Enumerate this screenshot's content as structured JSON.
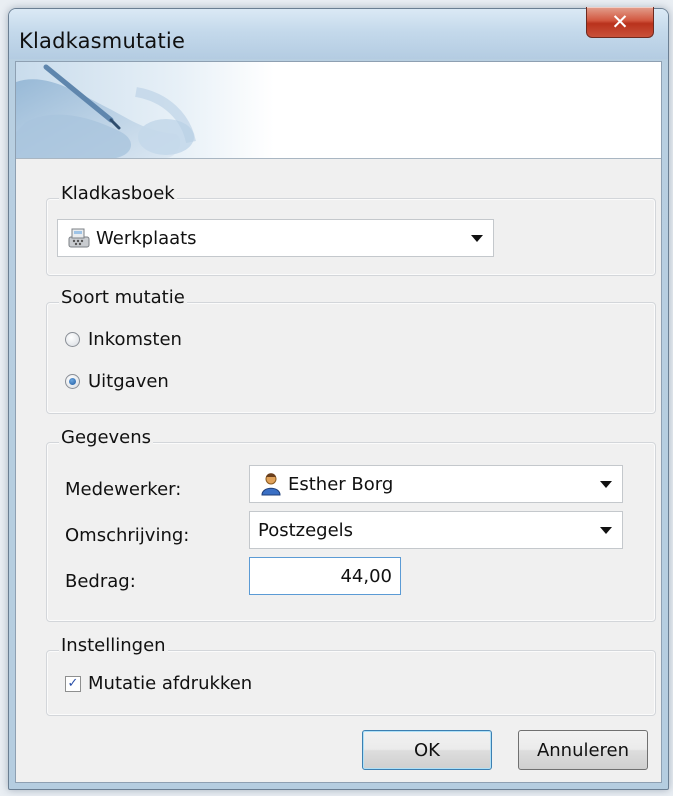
{
  "window": {
    "title": "Kladkasmutatie",
    "close_glyph": "✕"
  },
  "kladkasboek": {
    "legend": "Kladkasboek",
    "selected": "Werkplaats",
    "icon": "cash-register-icon"
  },
  "soort_mutatie": {
    "legend": "Soort mutatie",
    "options": [
      {
        "label": "Inkomsten",
        "selected": false
      },
      {
        "label": "Uitgaven",
        "selected": true
      }
    ]
  },
  "gegevens": {
    "legend": "Gegevens",
    "medewerker_label": "Medewerker:",
    "medewerker_value": "Esther Borg",
    "medewerker_icon": "person-icon",
    "omschrijving_label": "Omschrijving:",
    "omschrijving_value": "Postzegels",
    "bedrag_label": "Bedrag:",
    "bedrag_value": "44,00"
  },
  "instellingen": {
    "legend": "Instellingen",
    "afdrukken_label": "Mutatie afdrukken",
    "afdrukken_checked": true
  },
  "buttons": {
    "ok": "OK",
    "cancel": "Annuleren"
  }
}
